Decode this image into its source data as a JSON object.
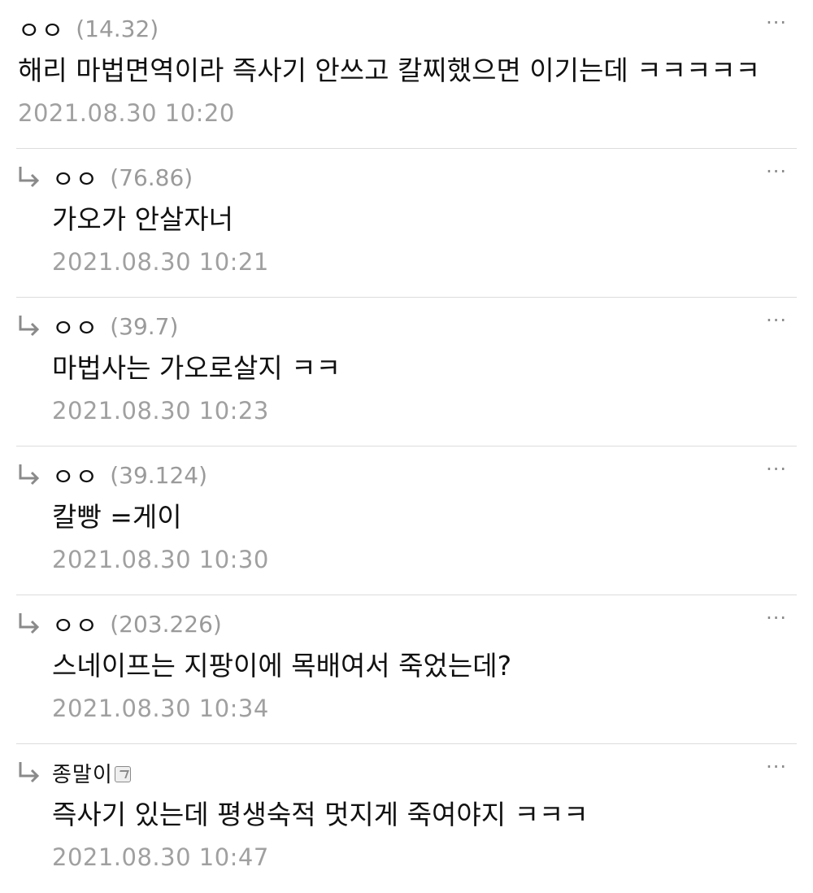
{
  "comments": [
    {
      "nick": "ㅇㅇ",
      "ip": "(14.32)",
      "text": "해리 마법면역이라 즉사기 안쓰고 칼찌했으면 이기는데 ㅋㅋㅋㅋㅋ",
      "date": "2021.08.30 10:20",
      "more": "···"
    },
    {
      "nick": "ㅇㅇ",
      "ip": "(76.86)",
      "text": "가오가 안살자너",
      "date": "2021.08.30 10:21",
      "more": "···"
    },
    {
      "nick": "ㅇㅇ",
      "ip": "(39.7)",
      "text": "마법사는 가오로살지 ㅋㅋ",
      "date": "2021.08.30 10:23",
      "more": "···"
    },
    {
      "nick": "ㅇㅇ",
      "ip": "(39.124)",
      "text": "칼빵 =게이",
      "date": "2021.08.30 10:30",
      "more": "···"
    },
    {
      "nick": "ㅇㅇ",
      "ip": "(203.226)",
      "text": "스네이프는 지팡이에 목배여서 죽었는데?",
      "date": "2021.08.30 10:34",
      "more": "···"
    },
    {
      "nick": "종말이",
      "text": "즉사기 있는데 평생숙적 멋지게 죽여야지 ㅋㅋㅋ",
      "date": "2021.08.30 10:47",
      "more": "···"
    }
  ],
  "icons": {
    "reply": "reply-arrow-icon",
    "more": "more-options-icon",
    "member_badge": "fixed-nick-badge-icon"
  },
  "colors": {
    "meta_gray": "#a0a0a0",
    "divider": "#dcdcdc",
    "icon_gray": "#8a8a8a"
  }
}
